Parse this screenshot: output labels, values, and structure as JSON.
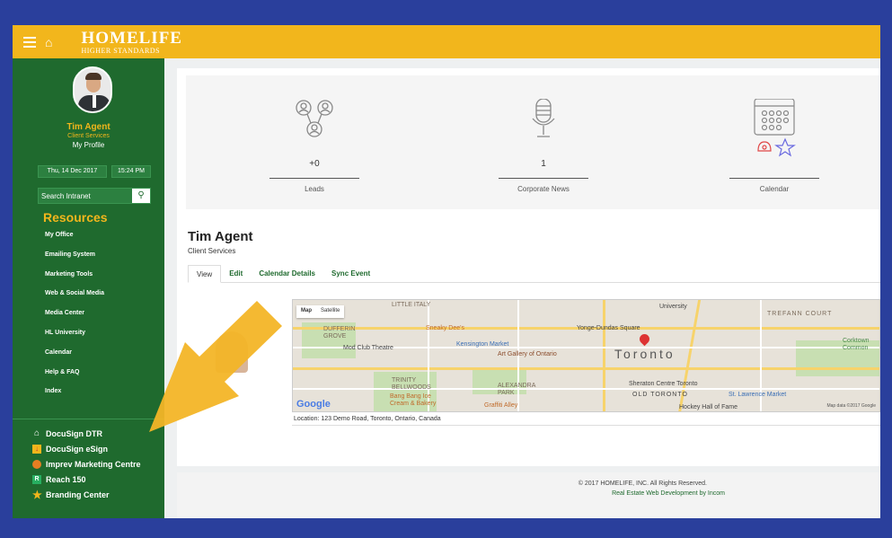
{
  "header": {
    "brand_name": "HOMELIFE",
    "brand_tagline": "HIGHER STANDARDS",
    "menu_icon": "hamburger-icon",
    "home_icon": "home-icon",
    "color": "#f2b61c"
  },
  "sidebar": {
    "user_name": "Tim Agent",
    "user_role": "Client Services",
    "profile_link": "My Profile",
    "date": "Thu, 14 Dec 2017",
    "time": "15:24 PM",
    "search_placeholder": "Search Intranet",
    "resources_heading": "Resources",
    "items": [
      {
        "label": "My Office"
      },
      {
        "label": "Emailing System"
      },
      {
        "label": "Marketing Tools"
      },
      {
        "label": "Web & Social Media"
      },
      {
        "label": "Media Center"
      },
      {
        "label": "HL University"
      },
      {
        "label": "Calendar"
      },
      {
        "label": "Help & FAQ"
      },
      {
        "label": "Index"
      }
    ],
    "links": [
      {
        "label": "DocuSign DTR",
        "icon": "house-outline-icon"
      },
      {
        "label": "DocuSign eSign",
        "icon": "docusign-icon"
      },
      {
        "label": "Imprev Marketing Centre",
        "icon": "imprev-icon"
      },
      {
        "label": "Reach 150",
        "icon": "reach-icon"
      },
      {
        "label": "Branding Center",
        "icon": "star-icon"
      }
    ],
    "color": "#1f6a2e"
  },
  "stats": [
    {
      "value": "+0",
      "label": "Leads",
      "icon": "people-icon"
    },
    {
      "value": "1",
      "label": "Corporate News",
      "icon": "microphone-icon"
    },
    {
      "value": "",
      "label": "Calendar",
      "icon": "calendar-icon"
    }
  ],
  "profile": {
    "name": "Tim Agent",
    "role": "Client Services",
    "tabs": [
      "View",
      "Edit",
      "Calendar Details",
      "Sync Event"
    ],
    "active_tab": "View",
    "location": "Location: 123 Demo Road, Toronto, Ontario, Canada"
  },
  "map": {
    "toggle": [
      "Map",
      "Satellite"
    ],
    "city_label": "Toronto",
    "labels": {
      "little_italy": "LITTLE ITALY",
      "dufferin": "DUFFERIN GROVE",
      "sneaky": "Sneaky Dee's",
      "kensington": "Kensington Market",
      "modclub": "Mod Club Theatre",
      "ago": "Art Gallery of Ontario",
      "trinity": "TRINITY BELLWOODS",
      "bangbang": "Bang Bang Ice Cream & Bakery",
      "alexandra": "ALEXANDRA PARK",
      "graffiti": "Graffiti Alley",
      "university": "University",
      "yonge": "Yonge-Dundas Square",
      "sheraton": "Sheraton Centre Toronto",
      "oldtoronto": "OLD TORONTO",
      "stlawrence": "St. Lawrence Market",
      "hockey": "Hockey Hall of Fame",
      "trefann": "TREFANN COURT",
      "corktown": "Corktown Common",
      "google": "Google",
      "copyright": "Map data ©2017 Google"
    }
  },
  "footer": {
    "copyright": "© 2017 HOMELIFE, INC. All Rights Reserved.",
    "credit": "Real Estate Web Development by Incom"
  }
}
